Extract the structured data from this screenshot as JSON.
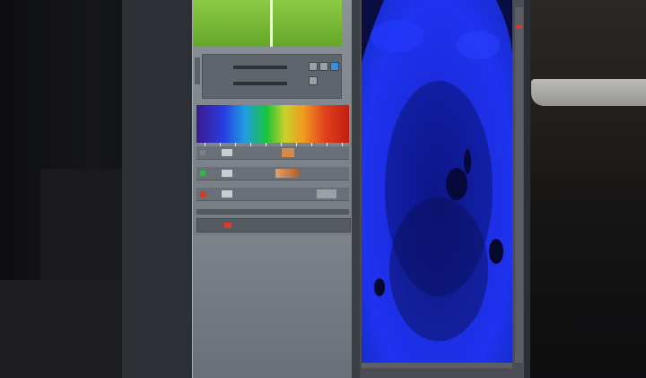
{
  "scene": {
    "description_icons": [
      "monitor",
      "microscopy-software-window"
    ],
    "accent_colors": {
      "nuclear_stain_blue": "#1f33f0",
      "panel_gray": "#7a8088",
      "green_bar": "#8cc944"
    }
  },
  "control_panel": {
    "slider_group": {
      "row_count": 2,
      "button_count": 4
    },
    "spectrum": {
      "tick_count": 10
    },
    "channels": [
      {
        "dot_color": "#7b8089"
      },
      {
        "dot_color": "#26c03c"
      },
      {
        "dot_color": "#e0341c"
      }
    ]
  },
  "viewer": {
    "image_channel_color": "#1f33f0"
  }
}
